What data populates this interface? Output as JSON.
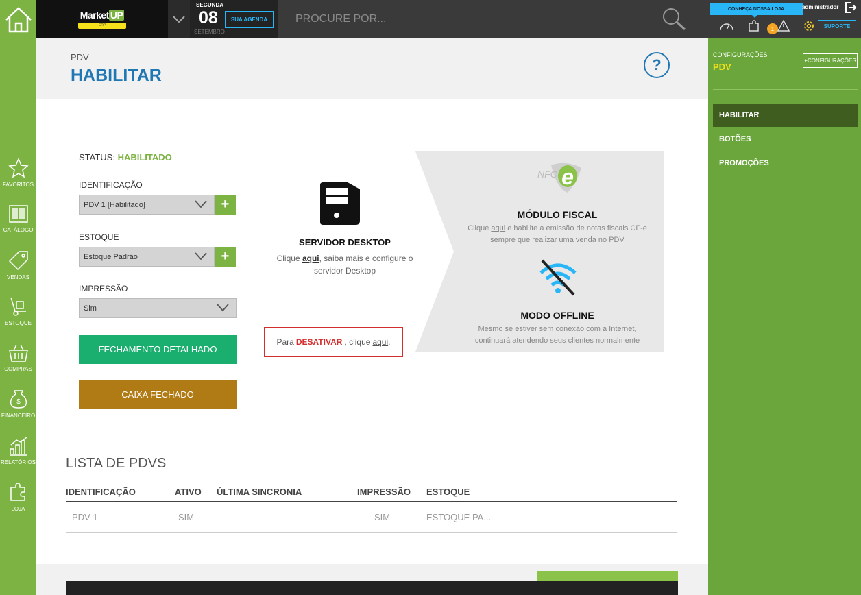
{
  "topbar": {
    "brand": "MarketUP",
    "brand_word1": "Market",
    "brand_word2": "UP",
    "brand_sub": "ERP",
    "weekday": "SEGUNDA",
    "day": "08",
    "month": "SETEMBRO",
    "agenda_label": "SUA AGENDA",
    "search_placeholder": "PROCURE POR...",
    "tooltip": "CONHEÇA NOSSA LOJA",
    "user": "administrador",
    "alert_count": "1",
    "support_label": "SUPORTE"
  },
  "leftnav": [
    {
      "label": "FAVORITOS",
      "icon": "star-icon"
    },
    {
      "label": "CATÁLOGO",
      "icon": "barcode-icon"
    },
    {
      "label": "VENDAS",
      "icon": "tag-icon"
    },
    {
      "label": "ESTOQUE",
      "icon": "hand-truck-icon"
    },
    {
      "label": "COMPRAS",
      "icon": "basket-icon"
    },
    {
      "label": "FINANCEIRO",
      "icon": "money-bag-icon"
    },
    {
      "label": "RELATÓRIOS",
      "icon": "bar-chart-icon"
    },
    {
      "label": "LOJA",
      "icon": "puzzle-icon"
    }
  ],
  "header": {
    "breadcrumb": "PDV",
    "title": "HABILITAR",
    "help": "?"
  },
  "form": {
    "status_label": "STATUS:",
    "status_value": "HABILITADO",
    "identificacao_label": "IDENTIFICAÇÃO",
    "identificacao_value": "PDV 1 [Habilitado]",
    "estoque_label": "ESTOQUE",
    "estoque_value": "Estoque Padrão",
    "impressao_label": "IMPRESSÃO",
    "impressao_value": "Sim",
    "plus": "+",
    "fechamento_button": "FECHAMENTO DETALHADO",
    "caixa_button": "CAIXA FECHADO"
  },
  "server": {
    "title": "SERVIDOR DESKTOP",
    "desc_pre": "Clique",
    "desc_link": "aqui",
    "desc_post": ", saiba mais e configure o servidor Desktop"
  },
  "deactivate": {
    "pre": "Para",
    "action": "DESATIVAR",
    "mid": ", clique",
    "link": "aqui",
    "post": "."
  },
  "fiscal": {
    "logo_text": "NFC",
    "title": "MÓDULO FISCAL",
    "desc_pre": "Clique",
    "desc_link": "aqui",
    "desc_post": "e habilite a emissão de notas fiscais CF-e sempre que realizar uma venda no PDV"
  },
  "offline": {
    "title": "MODO OFFLINE",
    "desc": "Mesmo se estiver sem conexão com a Internet, continuará atendendo seus clientes normalmente"
  },
  "list": {
    "title": "LISTA DE PDVS",
    "columns": [
      "IDENTIFICAÇÃO",
      "ATIVO",
      "ÚLTIMA SINCRONIA",
      "IMPRESSÃO",
      "ESTOQUE"
    ],
    "rows": [
      [
        "PDV 1",
        "SIM",
        "",
        "SIM",
        "ESTOQUE PA..."
      ]
    ]
  },
  "sidebar": {
    "section": "CONFIGURAÇÕES",
    "module": "PDV",
    "config_button": "+CONFIGURAÇÕES",
    "items": [
      "HABILITAR",
      "BOTÕES",
      "PROMOÇÕES"
    ],
    "active_item": "HABILITAR"
  },
  "colors": {
    "brand_green": "#7cb342",
    "title_blue": "#1f77b4",
    "accent_cyan": "#29b6f6",
    "status_green": "#7cb342",
    "btn_teal": "#1aae6f",
    "btn_gold": "#b07a14",
    "danger_red": "#d32f2f"
  }
}
